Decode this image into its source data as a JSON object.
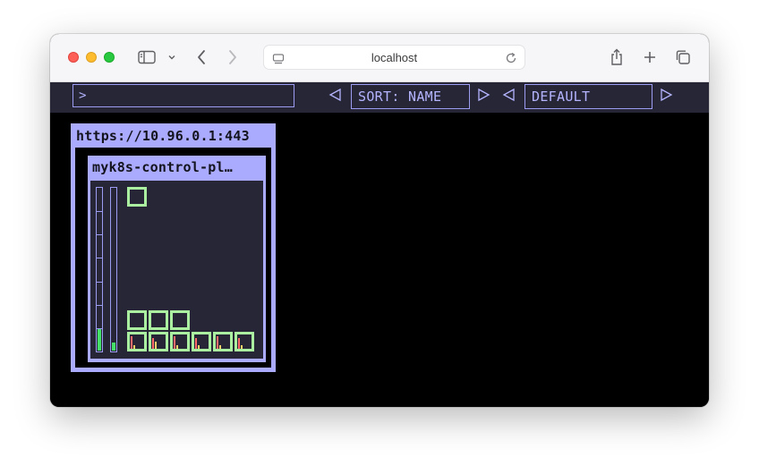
{
  "browser": {
    "url": "localhost",
    "icons": [
      "sidebar-icon",
      "chevron-down-icon",
      "back-icon",
      "forward-icon",
      "page-icon",
      "reload-icon",
      "share-icon",
      "plus-icon",
      "tabs-icon"
    ]
  },
  "toolbar": {
    "filter_value": ">",
    "sort_label": "SORT: NAME",
    "color_label": "DEFAULT"
  },
  "cluster": {
    "title": "https://10.96.0.1:443",
    "nodes": [
      {
        "title": "myk8s-control-pl…",
        "cpu_usage": 0.13,
        "memory_usage": 0.05,
        "pods_running": 10
      }
    ]
  },
  "colors": {
    "accent": "#aaaaff",
    "toolbar_bg": "#262637",
    "pod_ok": "#aaf0a0",
    "bar_fill": "#44e06a"
  }
}
